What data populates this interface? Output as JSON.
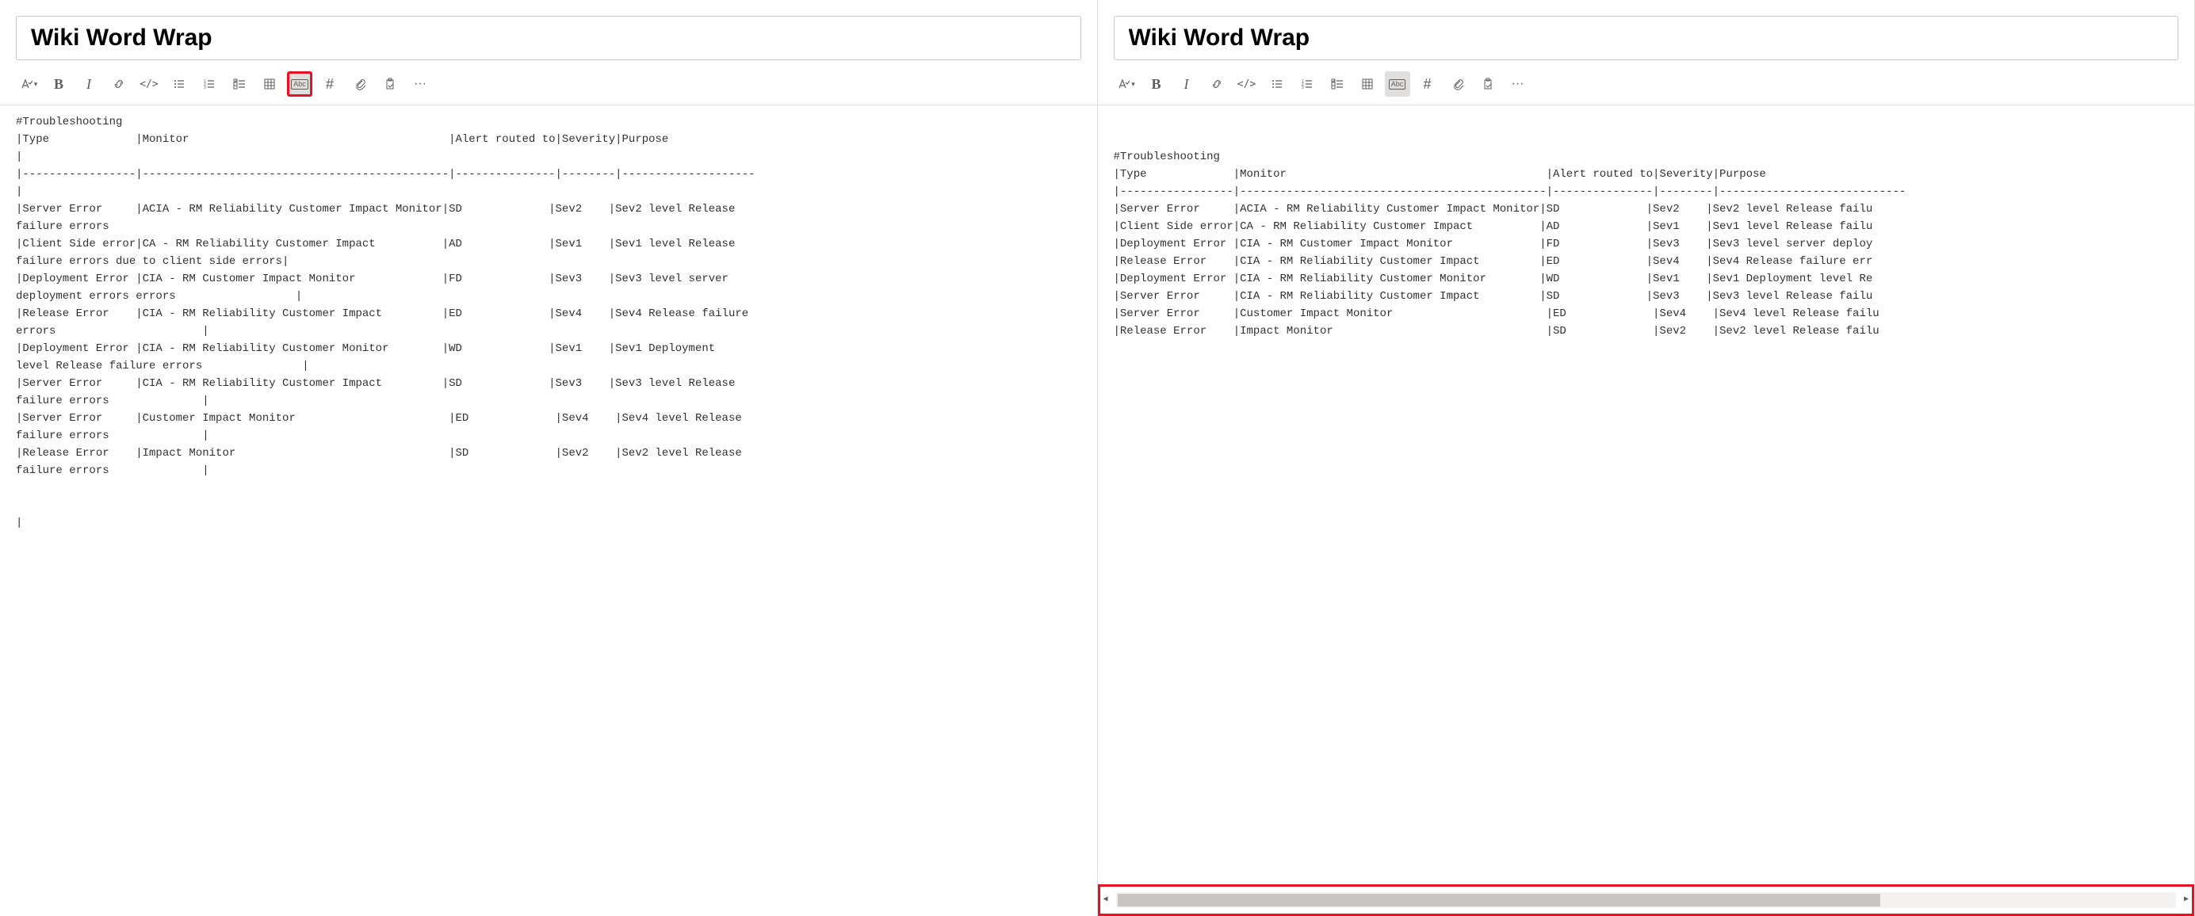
{
  "left": {
    "title": "Wiki Word Wrap",
    "toolbar": {
      "format_text": {
        "name": "format-text",
        "icon": "A✓"
      },
      "bold": {
        "name": "bold",
        "glyph": "B"
      },
      "italic": {
        "name": "italic",
        "glyph": "I"
      },
      "link": {
        "name": "link"
      },
      "code": {
        "name": "code",
        "glyph": "</>"
      },
      "bulleted": {
        "name": "bulleted-list"
      },
      "numbered": {
        "name": "numbered-list"
      },
      "checklist": {
        "name": "checklist"
      },
      "table": {
        "name": "table"
      },
      "word_wrap": {
        "name": "word-wrap",
        "label": "Abc",
        "active": true,
        "highlighted": true
      },
      "hash": {
        "name": "heading",
        "glyph": "#"
      },
      "attach": {
        "name": "attach"
      },
      "paste": {
        "name": "paste"
      },
      "more": {
        "name": "more",
        "glyph": "···"
      }
    },
    "lines": [
      "#Troubleshooting",
      "|Type             |Monitor                                       |Alert routed to|Severity|Purpose",
      "|",
      "|-----------------|----------------------------------------------|---------------|--------|--------------------",
      "|",
      "|Server Error     |ACIA - RM Reliability Customer Impact Monitor|SD             |Sev2    |Sev2 level Release",
      "failure errors",
      "|Client Side error|CA - RM Reliability Customer Impact          |AD             |Sev1    |Sev1 level Release",
      "failure errors due to client side errors|",
      "|Deployment Error |CIA - RM Customer Impact Monitor             |FD             |Sev3    |Sev3 level server",
      "deployment errors errors                  |",
      "|Release Error    |CIA - RM Reliability Customer Impact         |ED             |Sev4    |Sev4 Release failure",
      "errors                      |",
      "|Deployment Error |CIA - RM Reliability Customer Monitor        |WD             |Sev1    |Sev1 Deployment",
      "level Release failure errors               |",
      "|Server Error     |CIA - RM Reliability Customer Impact         |SD             |Sev3    |Sev3 level Release",
      "failure errors              |",
      "|Server Error     |Customer Impact Monitor                       |ED             |Sev4    |Sev4 level Release",
      "failure errors              |",
      "|Release Error    |Impact Monitor                                |SD             |Sev2    |Sev2 level Release",
      "failure errors              |",
      "",
      ""
    ]
  },
  "right": {
    "title": "Wiki Word Wrap",
    "toolbar": {
      "word_wrap": {
        "name": "word-wrap",
        "label": "Abc",
        "active": true,
        "highlighted": false
      }
    },
    "lines": [
      "#Troubleshooting",
      "|Type             |Monitor                                       |Alert routed to|Severity|Purpose",
      "|-----------------|----------------------------------------------|---------------|--------|----------------------------",
      "|Server Error     |ACIA - RM Reliability Customer Impact Monitor|SD             |Sev2    |Sev2 level Release failu",
      "|Client Side error|CA - RM Reliability Customer Impact          |AD             |Sev1    |Sev1 level Release failu",
      "|Deployment Error |CIA - RM Customer Impact Monitor             |FD             |Sev3    |Sev3 level server deploy",
      "|Release Error    |CIA - RM Reliability Customer Impact         |ED             |Sev4    |Sev4 Release failure err",
      "|Deployment Error |CIA - RM Reliability Customer Monitor        |WD             |Sev1    |Sev1 Deployment level Re",
      "|Server Error     |CIA - RM Reliability Customer Impact         |SD             |Sev3    |Sev3 level Release failu",
      "|Server Error     |Customer Impact Monitor                       |ED             |Sev4    |Sev4 level Release failu",
      "|Release Error    |Impact Monitor                                |SD             |Sev2    |Sev2 level Release failu"
    ]
  }
}
